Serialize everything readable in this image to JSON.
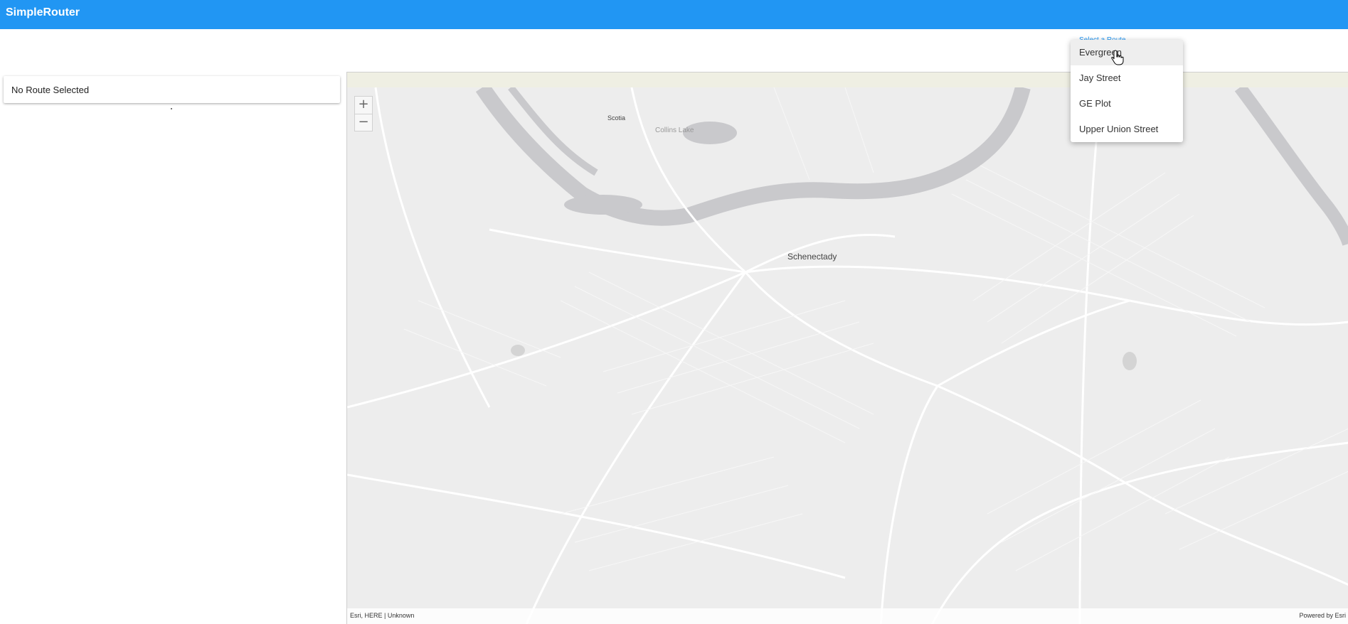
{
  "app": {
    "title": "SimpleRouter"
  },
  "route_panel": {
    "status": "No Route Selected"
  },
  "route_select": {
    "label": "Select a Route",
    "options": [
      "Evergreen",
      "Jay Street",
      "GE Plot",
      "Upper Union Street"
    ],
    "hovered": "Evergreen"
  },
  "map": {
    "zoom_in": "+",
    "zoom_out": "−",
    "labels": {
      "city": "Schenectady",
      "scotia": "Scotia",
      "lake": "Collins Lake"
    },
    "attribution": "Esri, HERE | Unknown",
    "powered_by": "Powered by Esri"
  },
  "colors": {
    "header": "#2196f3",
    "map_land": "#ededed",
    "water": "#c9c9cc"
  }
}
